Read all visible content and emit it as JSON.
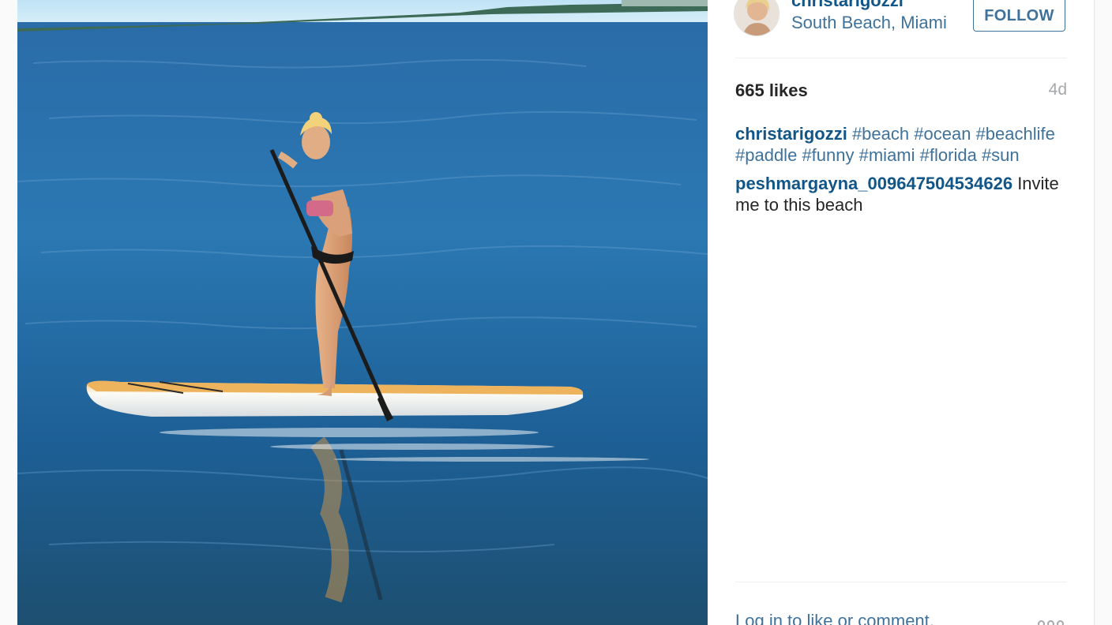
{
  "post": {
    "username": "christarigozzi",
    "location": "South Beach, Miami",
    "follow_label": "FOLLOW",
    "likes": "665 likes",
    "age": "4d"
  },
  "comments": [
    {
      "user": "christarigozzi",
      "text": "",
      "tags": [
        "#beach",
        "#ocean",
        "#beachlife",
        "#paddle",
        "#funny",
        "#miami",
        "#florida",
        "#sun"
      ]
    },
    {
      "user": "peshmargayna_009647504534626",
      "text": "Invite me to this beach",
      "tags": []
    }
  ],
  "footer": {
    "login_prompt": "Log in to like or comment.",
    "more_icon": "more-options-icon"
  },
  "colors": {
    "link": "#3f729b",
    "username": "#125688",
    "water": "#1f5f99"
  }
}
